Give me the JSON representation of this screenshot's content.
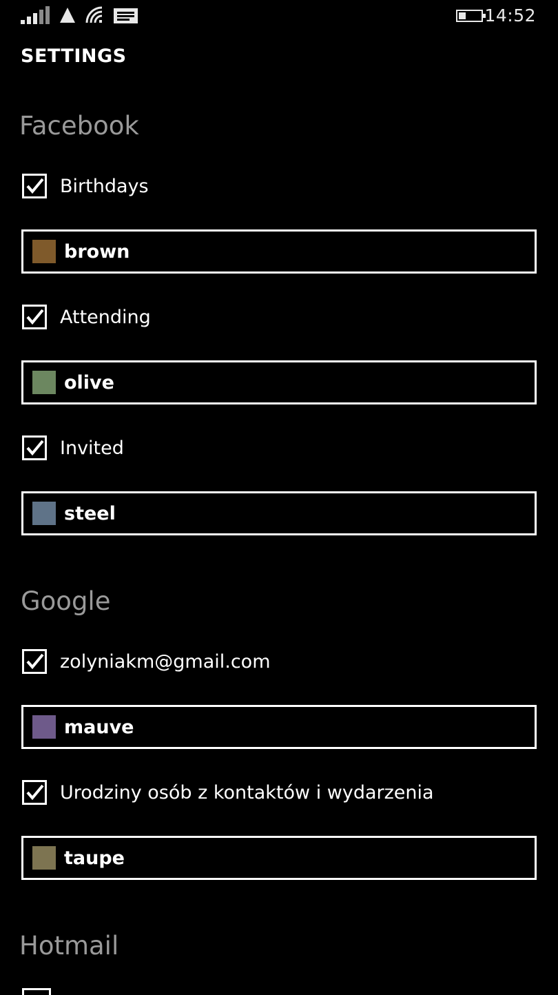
{
  "status_bar": {
    "time": "14:52",
    "icons": [
      "signal-strength-icon",
      "mobile-data-icon",
      "wifi-icon",
      "notification-icon",
      "battery-icon"
    ]
  },
  "page": {
    "title": "SETTINGS"
  },
  "sections": {
    "facebook": {
      "title": "Facebook",
      "items": [
        {
          "label": "Birthdays",
          "checked": true,
          "color_name": "brown",
          "color": "#7f5a2b"
        },
        {
          "label": "Attending",
          "checked": true,
          "color_name": "olive",
          "color": "#6c8760"
        },
        {
          "label": "Invited",
          "checked": true,
          "color_name": "steel",
          "color": "#5f7388"
        }
      ]
    },
    "google": {
      "title": "Google",
      "items": [
        {
          "label": "zolyniakm@gmail.com",
          "checked": true,
          "color_name": "mauve",
          "color": "#6e5a8a"
        },
        {
          "label": "Urodziny osób z kontaktów i wydarzenia",
          "checked": true,
          "color_name": "taupe",
          "color": "#7d7451"
        }
      ]
    },
    "hotmail": {
      "title": "Hotmail"
    }
  }
}
